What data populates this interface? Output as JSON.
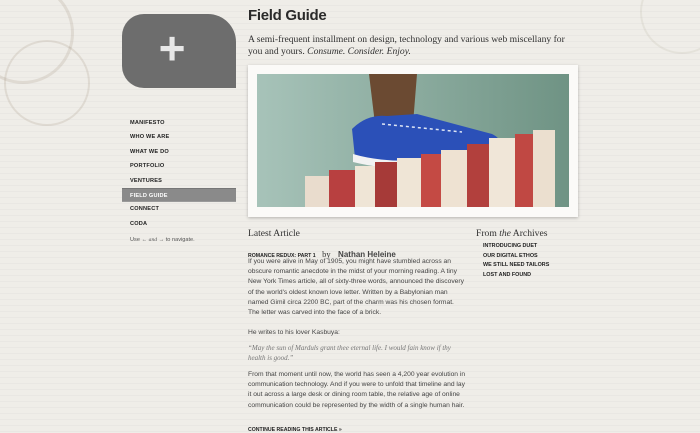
{
  "logo": {
    "symbol": "+"
  },
  "nav": {
    "items": [
      {
        "label": "MANIFESTO"
      },
      {
        "label": "WHO WE ARE"
      },
      {
        "label": "WHAT WE DO"
      },
      {
        "label": "PORTFOLIO"
      },
      {
        "label": "VENTURES"
      },
      {
        "label": "FIELD GUIDE",
        "active": true
      },
      {
        "label": "CONNECT"
      },
      {
        "label": "CODA"
      }
    ],
    "hint": {
      "pre": "Use ← ",
      "and": "and",
      "post": " → to navigate."
    }
  },
  "header": {
    "title": "Field Guide",
    "tagline": "A semi-frequent installment on design, technology and various web miscellany for you and yours.",
    "tagline_italic": "Consume. Consider. Enjoy."
  },
  "hero": {
    "subject": "blue-boat-shoe-on-stack-of-books"
  },
  "latest": {
    "heading": "Latest Article",
    "title": "ROMANCE REDUX: PART 1",
    "by": "by",
    "author": "Nathan Heleine",
    "p1": "If you were alive in May of 1905, you might have stumbled across an obscure romantic anecdote in the midst of your morning reading. A tiny New York Times article, all of sixty-three words, announced the discovery of the world's oldest known love letter. Written by a Babylonian man named Gimil circa 2200 BC, part of the charm was his chosen format. The letter was carved into the face of a brick.",
    "p2": "He writes to his lover Kasbuya:",
    "quote": "“May the sun of Marduls grant thee eternal life. I would fain know if thy health is good.”",
    "p3": "From that moment until now, the world has seen a 4,200 year evolution in communication technology. And if you were to unfold that timeline and lay it out across a large desk or dining room table, the relative age of online communication could be represented by the width of a single human hair.",
    "continue": "CONTINUE READING THIS ARTICLE »"
  },
  "archives": {
    "heading_pre": "From ",
    "heading_italic": "the",
    "heading_post": " Archives",
    "items": [
      "INTRODUCING DUET",
      "OUR DIGITAL ETHOS",
      "WE STILL NEED TAILORS",
      "LOST AND FOUND"
    ]
  },
  "colors": {
    "background": "#efede8",
    "logo": "#6d6d6d",
    "nav_active": "#8a8a8a",
    "shoe": "#2b50b8"
  }
}
